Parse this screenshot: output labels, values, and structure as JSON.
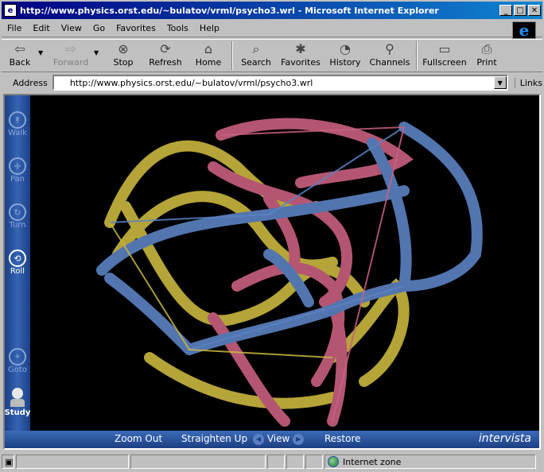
{
  "window": {
    "title": "http://www.physics.orst.edu/~bulatov/vrml/psycho3.wrl - Microsoft Internet Explorer",
    "minimize": "_",
    "maximize": "□",
    "close": "✕"
  },
  "menu": [
    "File",
    "Edit",
    "View",
    "Go",
    "Favorites",
    "Tools",
    "Help"
  ],
  "toolbar": {
    "back": "Back",
    "forward": "Forward",
    "stop": "Stop",
    "refresh": "Refresh",
    "home": "Home",
    "search": "Search",
    "favorites": "Favorites",
    "history": "History",
    "channels": "Channels",
    "fullscreen": "Fullscreen",
    "print": "Print"
  },
  "address": {
    "label": "Address",
    "url": "http://www.physics.orst.edu/~bulatov/vrml/psycho3.wrl",
    "links": "Links"
  },
  "vrml": {
    "nav": {
      "walk": "Walk",
      "pan": "Pan",
      "turn": "Turn",
      "roll": "Roll",
      "goto": "Goto",
      "study": "Study"
    },
    "bottom": {
      "zoom_out": "Zoom Out",
      "straighten_up": "Straighten Up",
      "view": "View",
      "restore": "Restore",
      "brand": "intervista"
    },
    "colors": {
      "yellow": "#c9b63e",
      "pink": "#c8607f",
      "blue": "#5b82c2"
    }
  },
  "status": {
    "zone": "Internet zone"
  }
}
